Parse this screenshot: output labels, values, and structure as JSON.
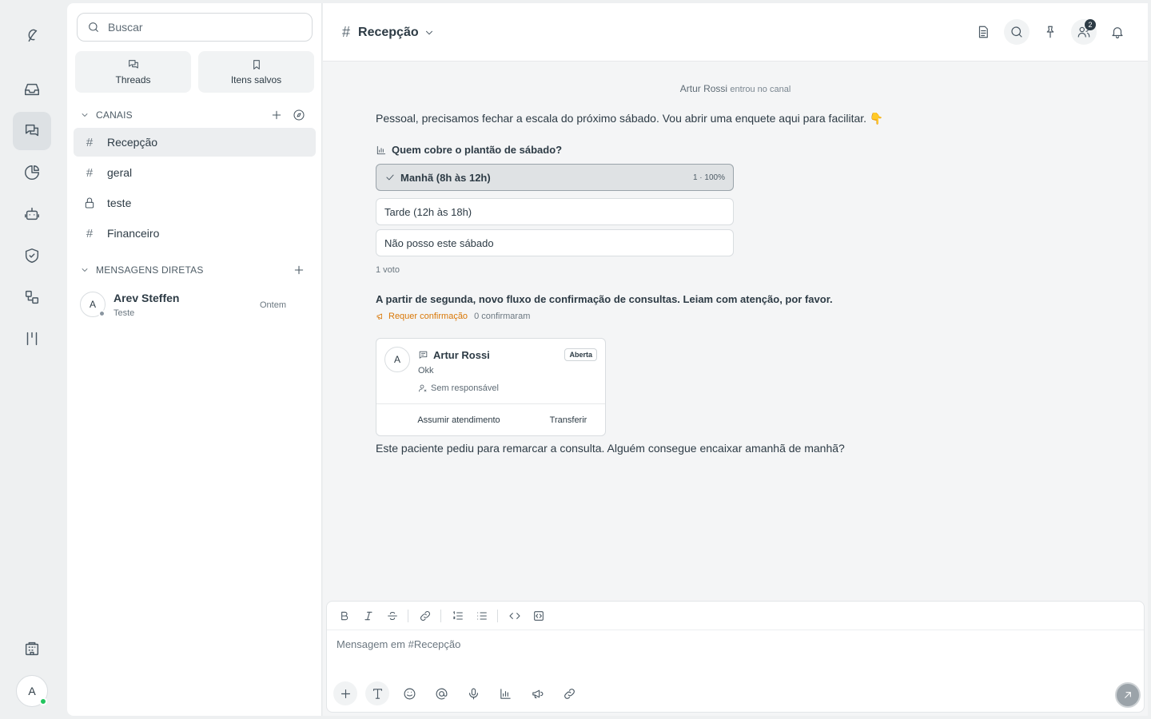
{
  "sidebar": {
    "search_placeholder": "Buscar",
    "quick": [
      {
        "label": "Threads",
        "icon": "threads-icon"
      },
      {
        "label": "Itens salvos",
        "icon": "bookmark-icon"
      }
    ],
    "channels_header": "CANAIS",
    "channels": [
      {
        "name": "Recepção",
        "type": "public",
        "active": true
      },
      {
        "name": "geral",
        "type": "public"
      },
      {
        "name": "teste",
        "type": "private"
      },
      {
        "name": "Financeiro",
        "type": "public"
      }
    ],
    "dm_header": "MENSAGENS DIRETAS",
    "dms": [
      {
        "initial": "A",
        "name": "Arev Steffen",
        "preview": "Teste",
        "time": "Ontem"
      }
    ]
  },
  "rail": {
    "avatar_initial": "A"
  },
  "channel": {
    "name": "Recepção",
    "members_badge": "2"
  },
  "feed": {
    "join": {
      "user": "Artur Rossi",
      "action": "entrou no canal"
    },
    "message1": "Pessoal, precisamos fechar a escala do próximo sábado. Vou abrir uma enquete aqui para facilitar. 👇",
    "poll": {
      "question": "Quem cobre o plantão de sábado?",
      "options": [
        {
          "label": "Manhã (8h às 12h)",
          "result": "1 · 100%",
          "selected": true
        },
        {
          "label": "Tarde (12h às 18h)"
        },
        {
          "label": "Não posso este sábado"
        }
      ],
      "votes": "1 voto"
    },
    "announcement": {
      "text": "A partir de segunda, novo fluxo de confirmação de consultas. Leiam com atenção, por favor.",
      "requires": "Requer confirmação",
      "confirmed": "0 confirmaram"
    },
    "ticket": {
      "initial": "A",
      "name": "Artur Rossi",
      "status": "Aberta",
      "body": "Okk",
      "assignee": "Sem responsável",
      "take_label": "Assumir atendimento",
      "transfer_label": "Transferir"
    },
    "message2": "Este paciente pediu para remarcar a consulta. Alguém consegue encaixar amanhã de manhã?"
  },
  "composer": {
    "placeholder": "Mensagem em #Recepção"
  },
  "colors": {
    "accent_warning": "#d97706",
    "online": "#22c55e"
  }
}
